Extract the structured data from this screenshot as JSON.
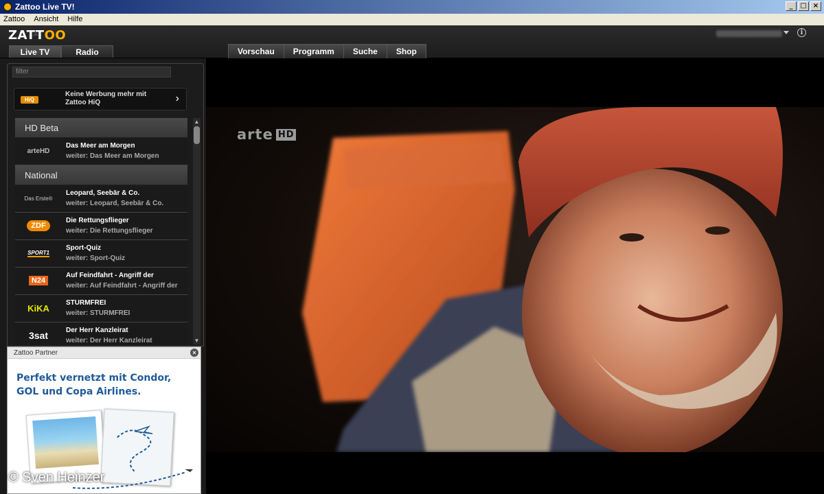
{
  "window": {
    "title": "Zattoo Live TV!",
    "buttons": [
      "_",
      "□",
      "×"
    ]
  },
  "menu": [
    "Zattoo",
    "Ansicht",
    "Hilfe"
  ],
  "header": {
    "logo": {
      "prefix": "ZATT",
      "highlight": "OO"
    },
    "left_tabs": [
      "Live TV",
      "Radio"
    ],
    "nav_tabs": [
      "Vorschau",
      "Programm",
      "Suche",
      "Shop"
    ],
    "info_glyph": "i"
  },
  "sidebar": {
    "filter_placeholder": "filter",
    "promo": {
      "badge": "HiQ",
      "text": "Keine Werbung mehr mit Zattoo HiQ"
    },
    "sections": [
      {
        "title": "HD Beta",
        "channels": [
          {
            "logo": "arteHD",
            "title": "Das Meer am Morgen",
            "next": "weiter: Das Meer am Morgen"
          }
        ]
      },
      {
        "title": "National",
        "channels": [
          {
            "logo": "Das Erste®",
            "title": "Leopard, Seebär & Co.",
            "next": "weiter: Leopard, Seebär & Co."
          },
          {
            "logo": "ZDF",
            "title": "Die Rettungsflieger",
            "next": "weiter: Die Rettungsflieger"
          },
          {
            "logo": "SPORT1",
            "title": "Sport-Quiz",
            "next": "weiter: Sport-Quiz"
          },
          {
            "logo": "N24",
            "title": "Auf Feindfahrt - Angriff der",
            "next": "weiter: Auf Feindfahrt - Angriff der"
          },
          {
            "logo": "KiKA",
            "title": "STURMFREI",
            "next": "weiter: STURMFREI"
          },
          {
            "logo": "3sat",
            "title": "Der Herr Kanzleirat",
            "next": "weiter: Der Herr Kanzleirat"
          }
        ]
      }
    ]
  },
  "partner": {
    "header": "Zattoo Partner",
    "ad_text": "Perfekt vernetzt mit Condor, GOL und Copa Airlines."
  },
  "video": {
    "channel_bug": "arte",
    "channel_bug_hd": "HD"
  },
  "watermark": "© Sven Heinzer"
}
